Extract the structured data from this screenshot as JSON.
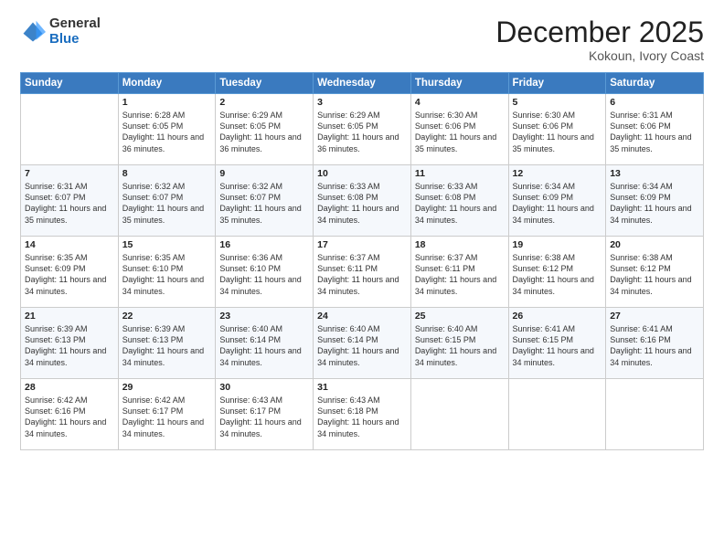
{
  "logo": {
    "general": "General",
    "blue": "Blue"
  },
  "header": {
    "month": "December 2025",
    "location": "Kokoun, Ivory Coast"
  },
  "weekdays": [
    "Sunday",
    "Monday",
    "Tuesday",
    "Wednesday",
    "Thursday",
    "Friday",
    "Saturday"
  ],
  "weeks": [
    [
      {
        "day": "",
        "sunrise": "",
        "sunset": "",
        "daylight": ""
      },
      {
        "day": "1",
        "sunrise": "Sunrise: 6:28 AM",
        "sunset": "Sunset: 6:05 PM",
        "daylight": "Daylight: 11 hours and 36 minutes."
      },
      {
        "day": "2",
        "sunrise": "Sunrise: 6:29 AM",
        "sunset": "Sunset: 6:05 PM",
        "daylight": "Daylight: 11 hours and 36 minutes."
      },
      {
        "day": "3",
        "sunrise": "Sunrise: 6:29 AM",
        "sunset": "Sunset: 6:05 PM",
        "daylight": "Daylight: 11 hours and 36 minutes."
      },
      {
        "day": "4",
        "sunrise": "Sunrise: 6:30 AM",
        "sunset": "Sunset: 6:06 PM",
        "daylight": "Daylight: 11 hours and 35 minutes."
      },
      {
        "day": "5",
        "sunrise": "Sunrise: 6:30 AM",
        "sunset": "Sunset: 6:06 PM",
        "daylight": "Daylight: 11 hours and 35 minutes."
      },
      {
        "day": "6",
        "sunrise": "Sunrise: 6:31 AM",
        "sunset": "Sunset: 6:06 PM",
        "daylight": "Daylight: 11 hours and 35 minutes."
      }
    ],
    [
      {
        "day": "7",
        "sunrise": "Sunrise: 6:31 AM",
        "sunset": "Sunset: 6:07 PM",
        "daylight": "Daylight: 11 hours and 35 minutes."
      },
      {
        "day": "8",
        "sunrise": "Sunrise: 6:32 AM",
        "sunset": "Sunset: 6:07 PM",
        "daylight": "Daylight: 11 hours and 35 minutes."
      },
      {
        "day": "9",
        "sunrise": "Sunrise: 6:32 AM",
        "sunset": "Sunset: 6:07 PM",
        "daylight": "Daylight: 11 hours and 35 minutes."
      },
      {
        "day": "10",
        "sunrise": "Sunrise: 6:33 AM",
        "sunset": "Sunset: 6:08 PM",
        "daylight": "Daylight: 11 hours and 34 minutes."
      },
      {
        "day": "11",
        "sunrise": "Sunrise: 6:33 AM",
        "sunset": "Sunset: 6:08 PM",
        "daylight": "Daylight: 11 hours and 34 minutes."
      },
      {
        "day": "12",
        "sunrise": "Sunrise: 6:34 AM",
        "sunset": "Sunset: 6:09 PM",
        "daylight": "Daylight: 11 hours and 34 minutes."
      },
      {
        "day": "13",
        "sunrise": "Sunrise: 6:34 AM",
        "sunset": "Sunset: 6:09 PM",
        "daylight": "Daylight: 11 hours and 34 minutes."
      }
    ],
    [
      {
        "day": "14",
        "sunrise": "Sunrise: 6:35 AM",
        "sunset": "Sunset: 6:09 PM",
        "daylight": "Daylight: 11 hours and 34 minutes."
      },
      {
        "day": "15",
        "sunrise": "Sunrise: 6:35 AM",
        "sunset": "Sunset: 6:10 PM",
        "daylight": "Daylight: 11 hours and 34 minutes."
      },
      {
        "day": "16",
        "sunrise": "Sunrise: 6:36 AM",
        "sunset": "Sunset: 6:10 PM",
        "daylight": "Daylight: 11 hours and 34 minutes."
      },
      {
        "day": "17",
        "sunrise": "Sunrise: 6:37 AM",
        "sunset": "Sunset: 6:11 PM",
        "daylight": "Daylight: 11 hours and 34 minutes."
      },
      {
        "day": "18",
        "sunrise": "Sunrise: 6:37 AM",
        "sunset": "Sunset: 6:11 PM",
        "daylight": "Daylight: 11 hours and 34 minutes."
      },
      {
        "day": "19",
        "sunrise": "Sunrise: 6:38 AM",
        "sunset": "Sunset: 6:12 PM",
        "daylight": "Daylight: 11 hours and 34 minutes."
      },
      {
        "day": "20",
        "sunrise": "Sunrise: 6:38 AM",
        "sunset": "Sunset: 6:12 PM",
        "daylight": "Daylight: 11 hours and 34 minutes."
      }
    ],
    [
      {
        "day": "21",
        "sunrise": "Sunrise: 6:39 AM",
        "sunset": "Sunset: 6:13 PM",
        "daylight": "Daylight: 11 hours and 34 minutes."
      },
      {
        "day": "22",
        "sunrise": "Sunrise: 6:39 AM",
        "sunset": "Sunset: 6:13 PM",
        "daylight": "Daylight: 11 hours and 34 minutes."
      },
      {
        "day": "23",
        "sunrise": "Sunrise: 6:40 AM",
        "sunset": "Sunset: 6:14 PM",
        "daylight": "Daylight: 11 hours and 34 minutes."
      },
      {
        "day": "24",
        "sunrise": "Sunrise: 6:40 AM",
        "sunset": "Sunset: 6:14 PM",
        "daylight": "Daylight: 11 hours and 34 minutes."
      },
      {
        "day": "25",
        "sunrise": "Sunrise: 6:40 AM",
        "sunset": "Sunset: 6:15 PM",
        "daylight": "Daylight: 11 hours and 34 minutes."
      },
      {
        "day": "26",
        "sunrise": "Sunrise: 6:41 AM",
        "sunset": "Sunset: 6:15 PM",
        "daylight": "Daylight: 11 hours and 34 minutes."
      },
      {
        "day": "27",
        "sunrise": "Sunrise: 6:41 AM",
        "sunset": "Sunset: 6:16 PM",
        "daylight": "Daylight: 11 hours and 34 minutes."
      }
    ],
    [
      {
        "day": "28",
        "sunrise": "Sunrise: 6:42 AM",
        "sunset": "Sunset: 6:16 PM",
        "daylight": "Daylight: 11 hours and 34 minutes."
      },
      {
        "day": "29",
        "sunrise": "Sunrise: 6:42 AM",
        "sunset": "Sunset: 6:17 PM",
        "daylight": "Daylight: 11 hours and 34 minutes."
      },
      {
        "day": "30",
        "sunrise": "Sunrise: 6:43 AM",
        "sunset": "Sunset: 6:17 PM",
        "daylight": "Daylight: 11 hours and 34 minutes."
      },
      {
        "day": "31",
        "sunrise": "Sunrise: 6:43 AM",
        "sunset": "Sunset: 6:18 PM",
        "daylight": "Daylight: 11 hours and 34 minutes."
      },
      {
        "day": "",
        "sunrise": "",
        "sunset": "",
        "daylight": ""
      },
      {
        "day": "",
        "sunrise": "",
        "sunset": "",
        "daylight": ""
      },
      {
        "day": "",
        "sunrise": "",
        "sunset": "",
        "daylight": ""
      }
    ]
  ]
}
